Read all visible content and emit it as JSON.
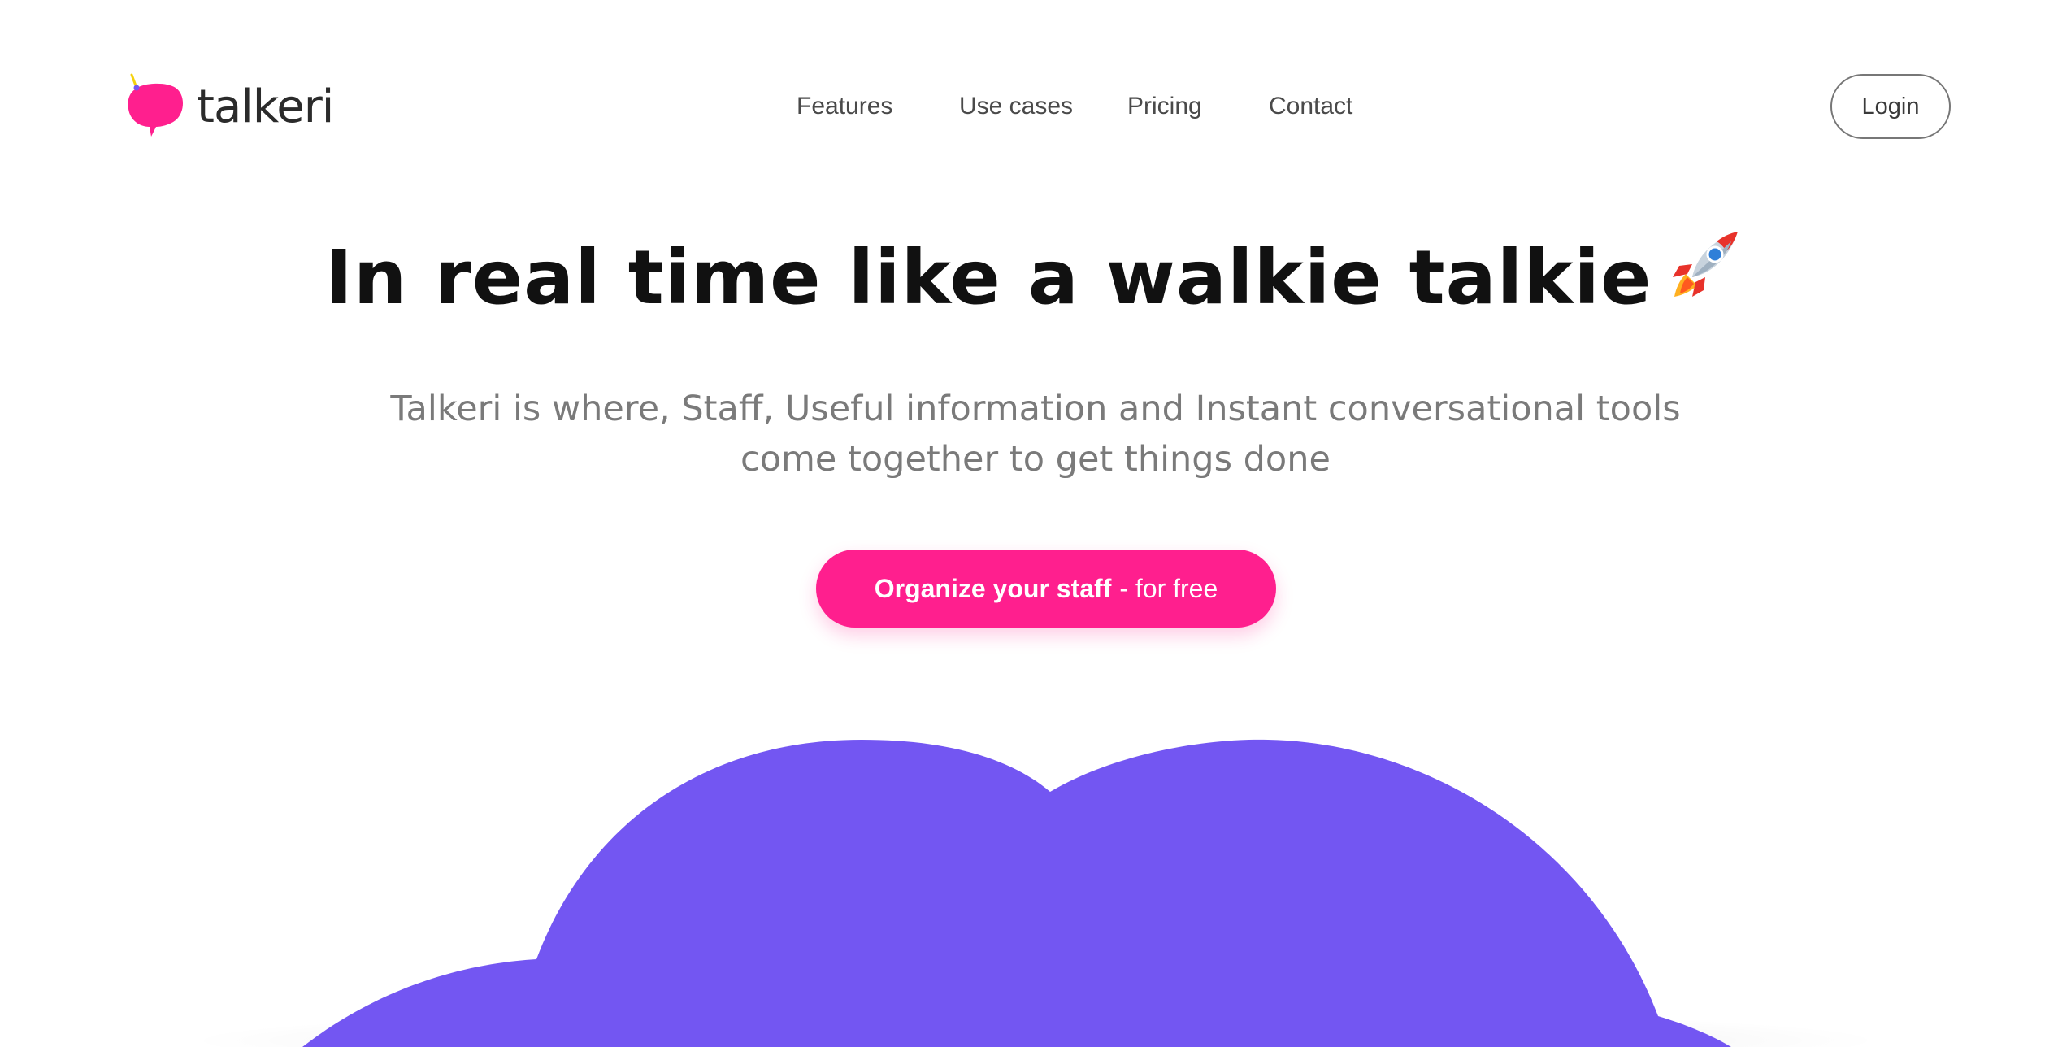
{
  "header": {
    "logo_text": "talkeri",
    "logo_icon": "speech-bubble-antenna-icon",
    "nav": [
      {
        "label": "Features"
      },
      {
        "label": "Use cases"
      },
      {
        "label": "Pricing"
      },
      {
        "label": "Contact"
      }
    ],
    "login_label": "Login"
  },
  "hero": {
    "title": "In real time like a walkie talkie",
    "title_icon": "rocket-icon",
    "subtitle_line1": "Talkeri is where, Staff, Useful information and Instant conversational tools",
    "subtitle_line2": "come together to get things done",
    "cta_strong": "Organize your staff",
    "cta_light": "- for free"
  },
  "colors": {
    "brand_pink": "#ff1f8e",
    "cloud_purple": "#7356f2",
    "title": "#111111",
    "subtitle": "#7a7a7a"
  }
}
